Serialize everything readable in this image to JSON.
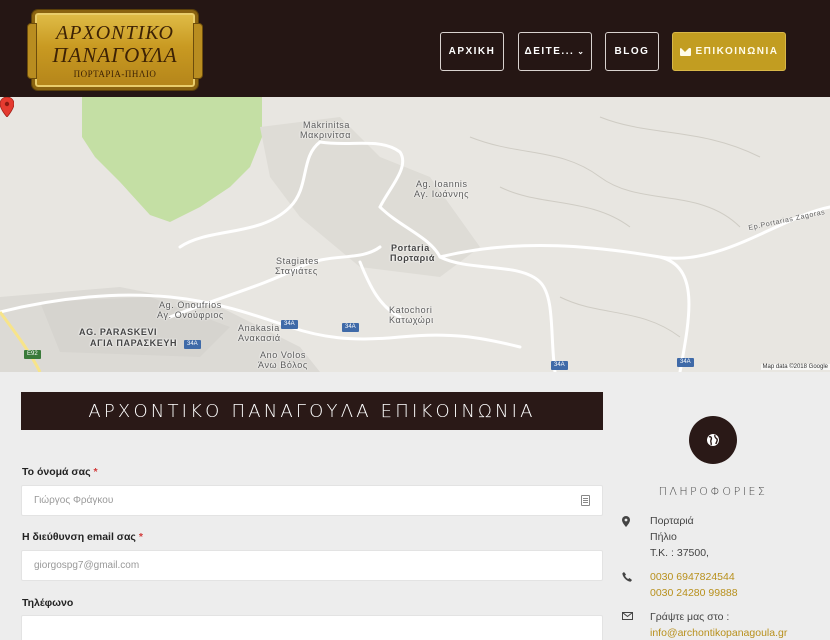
{
  "header": {
    "logo": {
      "line1": "ΑΡΧΟΝΤΙΚΟ",
      "line2": "ΠΑΝΑΓΟΥΛΑ",
      "line3": "ΠΟΡΤΑΡΙΑ-ΠΗΛΙΟ"
    },
    "nav": {
      "home": "ΑΡΧΙΚΗ",
      "see": "ΔΕΙΤΕ...",
      "blog": "BLOG",
      "contact": "ΕΠΙΚΟΙΝΩΝΙΑ"
    },
    "colors": {
      "background": "#251614",
      "accent": "#c29d21"
    }
  },
  "map": {
    "labels": {
      "makrinitsa": "Makrinitsa",
      "makrinitsa_gr": "Μακρινίτσα",
      "ioannis": "Ag. Ioannis",
      "ioannis_gr": "Αγ. Ιωάννης",
      "portaria": "Portaria",
      "portaria_gr": "Πορταριά",
      "stagiates": "Stagiates",
      "stagiates_gr": "Σταγιάτες",
      "onoufrios": "Ag. Onoufrios",
      "onoufrios_gr": "Αγ. Ονούφριος",
      "paraskevi": "AG. PARASKEVI",
      "paraskevi_gr": "ΑΓΙΑ ΠΑΡΑΣΚΕΥΗ",
      "anakasia": "Anakasia",
      "anakasia_gr": "Ανακασιά",
      "katochori": "Katochori",
      "katochori_gr": "Κατωχώρι",
      "ano_volos": "Ano Volos",
      "ano_volos_gr": "Άνω Βόλος",
      "road_zagora": "Ep.Portarias Zagoras"
    },
    "road_signs": {
      "s1": "34A",
      "s2": "34A",
      "s3": "34A",
      "s4": "34A",
      "s5": "34A",
      "s6": "E92"
    },
    "credit": "Map data ©2018 Google"
  },
  "form": {
    "title": "ΑΡΧΟΝΤΙΚΟ ΠΑΝΑΓΟΥΛΑ ΕΠΙΚΟΙΝΩΝΙΑ",
    "name_label": "Το όνομά σας",
    "name_placeholder": "Γιώργος Φράγκου",
    "email_label": "Η διεύθυνση email σας",
    "email_placeholder": "giorgospg7@gmail.com",
    "phone_label": "Τηλέφωνο",
    "required_mark": "*"
  },
  "info": {
    "title": "ΠΛΗΡΟΦΟΡΙΕΣ",
    "address_line1": "Πορταριά",
    "address_line2": "Πήλιο",
    "address_line3": "Τ.Κ. : 37500,",
    "phone1": "0030 6947824544",
    "phone2": "0030 24280 99888",
    "write_label": "Γράψτε μας στο :",
    "email": "info@archontikopanagoula.gr"
  }
}
